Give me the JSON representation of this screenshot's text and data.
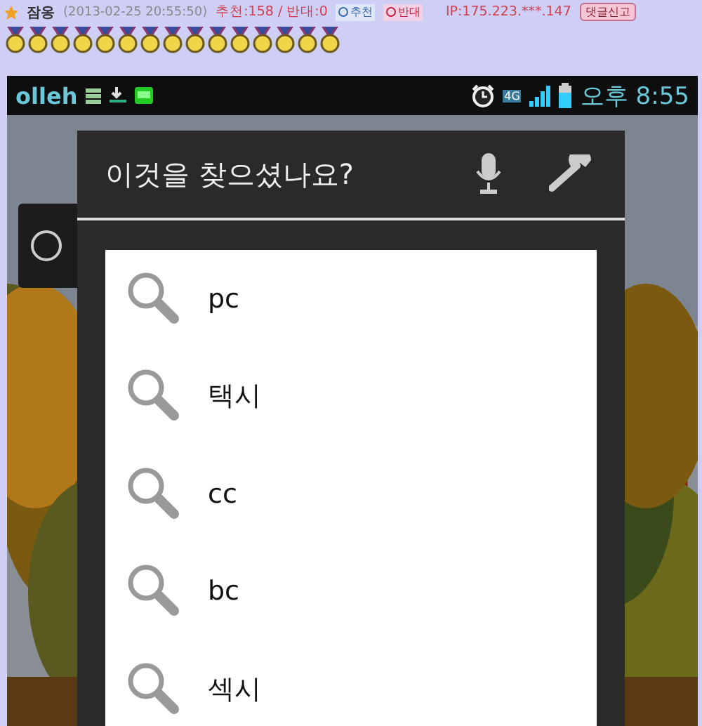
{
  "post": {
    "author": "잠옹",
    "timestamp": "(2013-02-25 20:55:50)",
    "votes": "추천:158 / 반대:0",
    "buttons": [
      {
        "label": "추천",
        "kind": "up"
      },
      {
        "label": "반대",
        "kind": "down"
      }
    ],
    "ip": "IP:175.223.***.147",
    "report_button": "댓글신고",
    "medals": [
      {
        "kind": "medal"
      },
      {
        "kind": "medal"
      },
      {
        "kind": "medal"
      },
      {
        "kind": "medal"
      },
      {
        "kind": "medal"
      },
      {
        "kind": "medal"
      },
      {
        "kind": "medal"
      },
      {
        "kind": "medal"
      },
      {
        "kind": "medal"
      },
      {
        "kind": "medal"
      },
      {
        "kind": "medal"
      },
      {
        "kind": "medal"
      },
      {
        "kind": "medal"
      },
      {
        "kind": "medal"
      },
      {
        "kind": "medal"
      }
    ]
  },
  "phone": {
    "status_bar": {
      "carrier": "olleh",
      "network": "4G",
      "time": "오후 8:55"
    },
    "dialog": {
      "title": "이것을 찾으셨나요?",
      "suggestions": [
        "pc",
        "택시",
        "cc",
        "bc",
        "섹시"
      ]
    }
  }
}
